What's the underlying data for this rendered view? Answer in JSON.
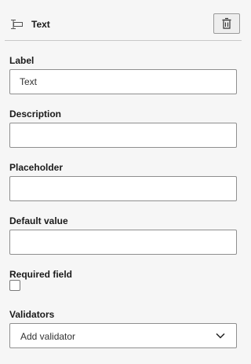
{
  "header": {
    "title": "Text",
    "type_icon": "text-field-icon",
    "delete_icon": "trash-icon"
  },
  "fields": {
    "label": {
      "label": "Label",
      "value": "Text"
    },
    "description": {
      "label": "Description",
      "value": ""
    },
    "placeholder": {
      "label": "Placeholder",
      "value": ""
    },
    "default_value": {
      "label": "Default value",
      "value": ""
    },
    "required": {
      "label": "Required field",
      "checked": false
    },
    "validators": {
      "label": "Validators",
      "selected": "Add validator",
      "icon": "chevron-down-icon"
    }
  }
}
